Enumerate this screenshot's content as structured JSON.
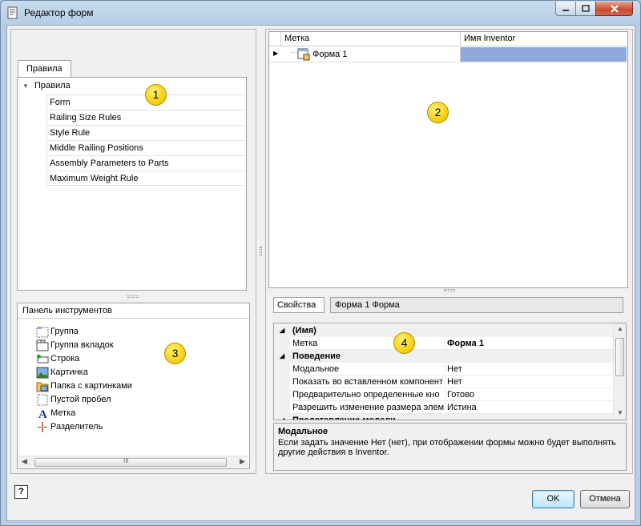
{
  "window": {
    "title": "Редактор форм"
  },
  "rules_panel": {
    "tab_label": "Правила",
    "root_label": "Правила",
    "items": [
      "Form",
      "Railing Size Rules",
      "Style Rule",
      "Middle Railing Positions",
      "Assembly Parameters to Parts",
      "Maximum Weight Rule"
    ]
  },
  "toolbox": {
    "header": "Панель инструментов",
    "items": [
      {
        "label": "Группа",
        "icon": "group-icon"
      },
      {
        "label": "Группа вкладок",
        "icon": "tab-group-icon"
      },
      {
        "label": "Строка",
        "icon": "row-icon"
      },
      {
        "label": "Картинка",
        "icon": "picture-icon"
      },
      {
        "label": "Папка с картинками",
        "icon": "picture-folder-icon"
      },
      {
        "label": "Пустой пробел",
        "icon": "empty-space-icon"
      },
      {
        "label": "Метка",
        "icon": "label-icon"
      },
      {
        "label": "Разделитель",
        "icon": "splitter-icon"
      }
    ],
    "scroll_thumb_label": "III"
  },
  "form_grid": {
    "columns": [
      "Метка",
      "Имя Inventor"
    ],
    "row": {
      "label": "Форма 1",
      "inventor_name": ""
    }
  },
  "properties": {
    "label": "Свойства",
    "object": "Форма 1 Форма",
    "rows": [
      {
        "type": "category",
        "name": "(Имя)"
      },
      {
        "type": "prop",
        "name": "Метка",
        "value": "Форма 1",
        "bold": true
      },
      {
        "type": "category",
        "name": "Поведение"
      },
      {
        "type": "prop",
        "name": "Модальное",
        "value": "Нет"
      },
      {
        "type": "prop",
        "name": "Показать во вставленном компонент",
        "value": "Нет"
      },
      {
        "type": "prop",
        "name": "Предварительно определенные кно",
        "value": "Готово"
      },
      {
        "type": "prop",
        "name": "Разрешить изменение размера элем",
        "value": "Истина"
      },
      {
        "type": "category",
        "name": "Представление модели"
      }
    ]
  },
  "description": {
    "title": "Модальное",
    "text": "Если задать значение Нет (нет), при отображении формы можно будет выполнять другие действия в Inventor."
  },
  "buttons": {
    "ok": "OK",
    "cancel": "Отмена",
    "help": "?"
  },
  "callouts": [
    "1",
    "2",
    "3",
    "4"
  ],
  "colors": {
    "selection": "#8fa9dc",
    "callout": "#f5cc00"
  }
}
